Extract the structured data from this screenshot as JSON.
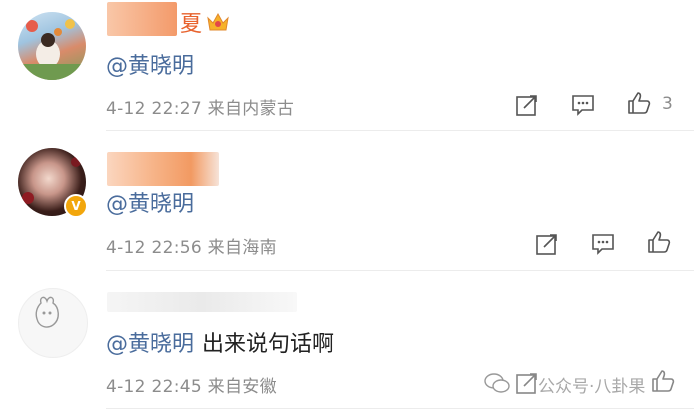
{
  "comments": [
    {
      "name_suffix": "夏",
      "mention": "@黄晓明",
      "text": "",
      "meta": "4-12 22:27 来自内蒙古",
      "likes": "3"
    },
    {
      "name_suffix": "",
      "mention": "@黄晓明",
      "text": "",
      "meta": "4-12 22:56 来自海南",
      "likes": ""
    },
    {
      "name_suffix": "",
      "mention": "@黄晓明",
      "text": "出来说句话啊",
      "meta": "4-12 22:45 来自安徽",
      "likes": ""
    }
  ],
  "icons": {
    "repost": "repost-icon",
    "comment": "comment-icon",
    "like": "thumbs-up-icon",
    "crown": "crown-icon",
    "verified": "verified-badge-icon"
  },
  "watermark": "公众号·八卦果",
  "colors": {
    "mention": "#4a6c9c",
    "meta": "#8c8c8c",
    "badge": "#f2a60c",
    "blur": "#f6a57a"
  }
}
